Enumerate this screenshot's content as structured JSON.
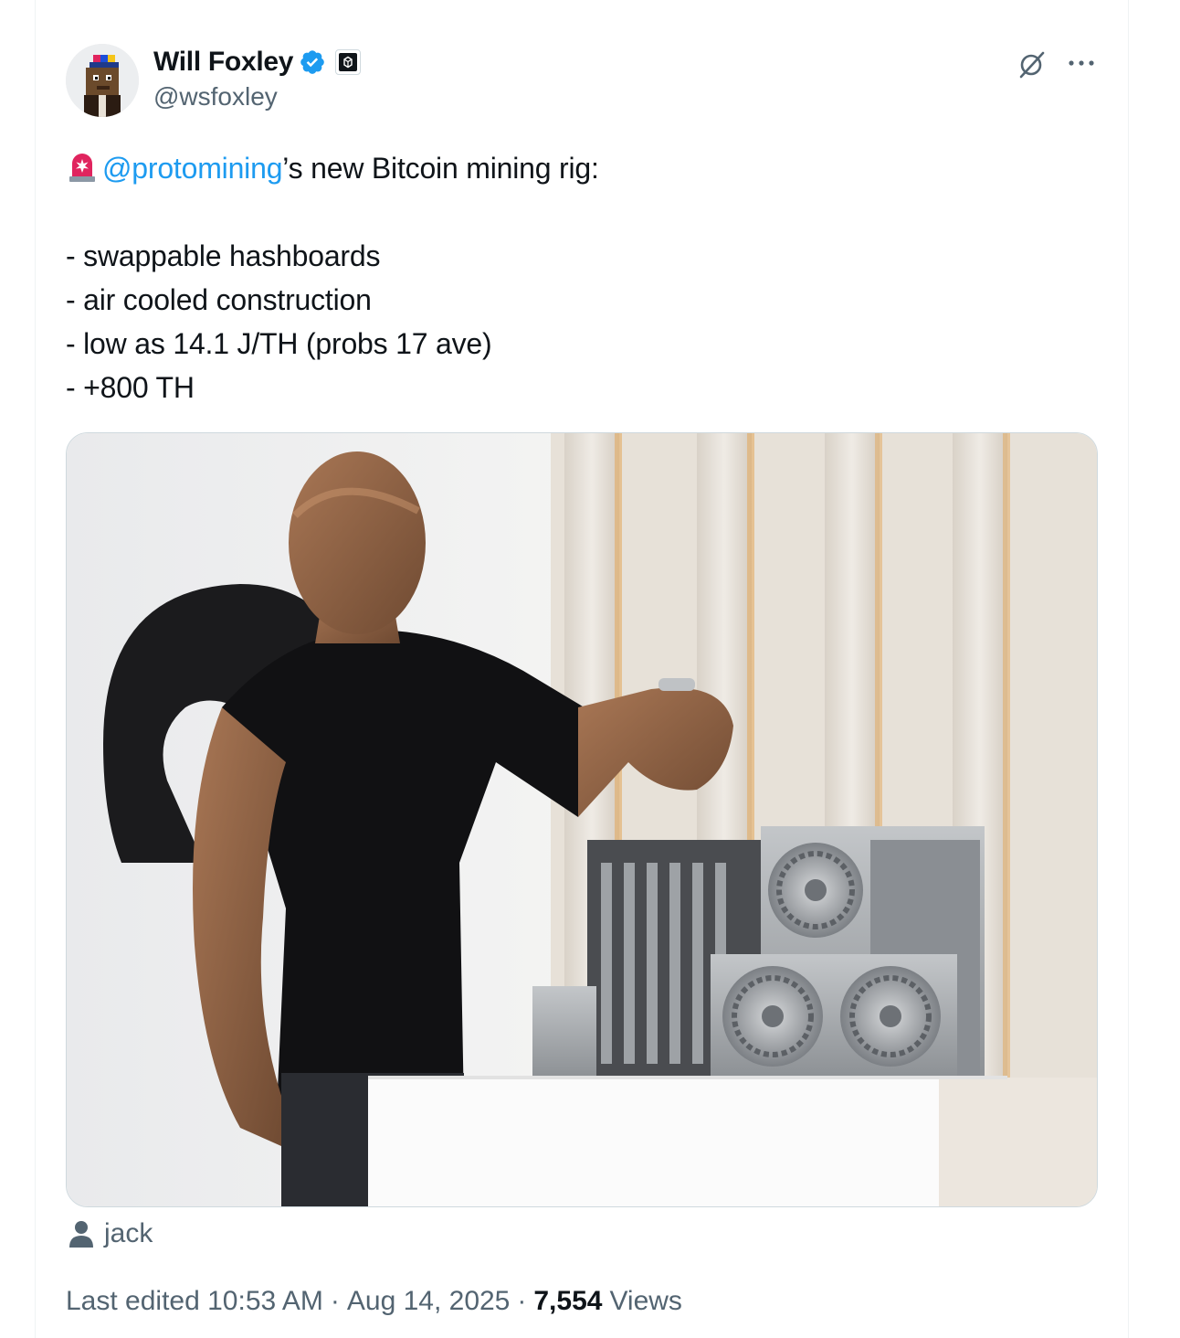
{
  "author": {
    "display_name": "Will Foxley",
    "handle": "@wsfoxley",
    "verified": true
  },
  "icons": {
    "avatar": "pixel-art-avatar",
    "verified": "verified-badge-icon",
    "affiliation": "affiliation-badge-icon",
    "grok": "grok-icon",
    "more": "more-icon",
    "siren": "siren-emoji",
    "person": "person-icon"
  },
  "tweet": {
    "mention": "@protomining",
    "line1_rest": "’s new Bitcoin mining rig:",
    "bullets": [
      "- swappable hashboards",
      "- air cooled construction",
      "- low as 14.1 J/TH (probs 17 ave)",
      "- +800 TH"
    ]
  },
  "media": {
    "tagged_user": "jack"
  },
  "meta": {
    "edited": "Last edited 10:53 AM",
    "sep": "·",
    "date": "Aug 14, 2025",
    "views_count": "7,554",
    "views_label": "Views"
  },
  "colors": {
    "accent": "#1d9bf0",
    "secondary_text": "#536471",
    "primary_text": "#0f1419",
    "border": "#cfd9de"
  }
}
